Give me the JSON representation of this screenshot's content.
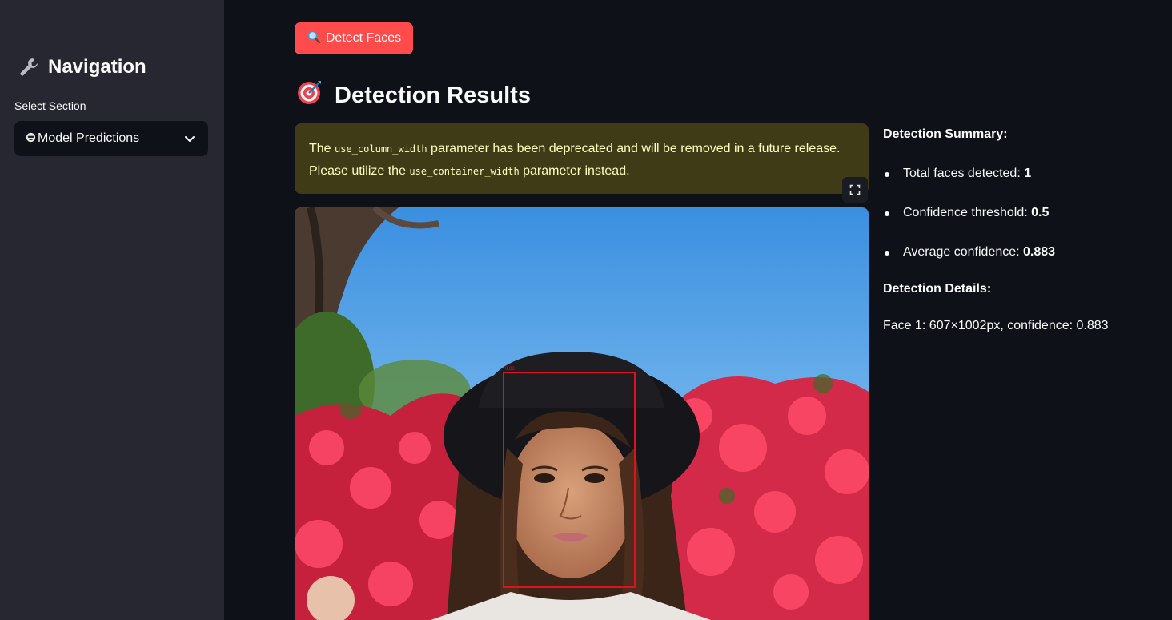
{
  "sidebar": {
    "title": "Navigation",
    "title_icon": "wrench-icon",
    "select_label": "Select Section",
    "select_value": "Model Predictions",
    "select_value_icon": "face-emoji-icon"
  },
  "main": {
    "detect_button_label": "Detect Faces",
    "detect_button_icon": "magnifier-icon",
    "results_title": "Detection Results",
    "results_title_icon": "target-icon",
    "warning": {
      "t1": "The ",
      "code1": "use_column_width",
      "t2": " parameter has been deprecated and will be removed in a future release. Please utilize the ",
      "code2": "use_container_width",
      "t3": " parameter instead."
    },
    "image": {
      "description_icon": "face-photo",
      "box_label": "0.88"
    }
  },
  "summary": {
    "heading": "Detection Summary:",
    "items": [
      {
        "label": "Total faces detected: ",
        "value": "1"
      },
      {
        "label": "Confidence threshold: ",
        "value": "0.5"
      },
      {
        "label": "Average confidence: ",
        "value": "0.883"
      }
    ],
    "details_heading": "Detection Details:",
    "face_line": "Face 1: 607×1002px, confidence: 0.883"
  },
  "colors": {
    "background": "#0e1117",
    "sidebar": "#262730",
    "primary_button": "#ff4b4b",
    "warning_bg": "#3e3b16",
    "warning_text": "#ffffc2",
    "bbox": "#e01020"
  }
}
